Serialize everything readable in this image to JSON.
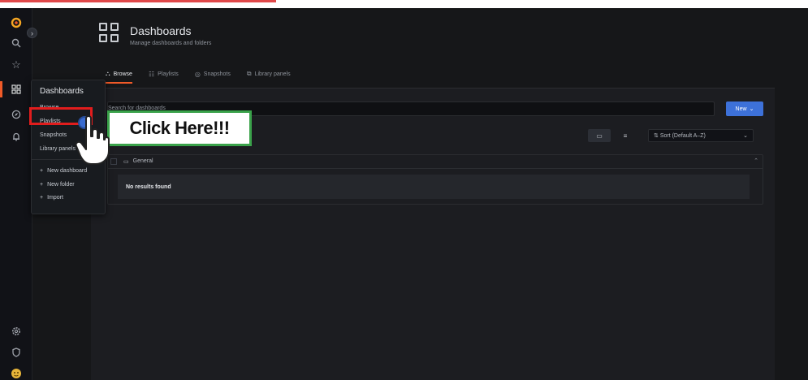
{
  "header": {
    "title": "Dashboards",
    "subtitle": "Manage dashboards and folders"
  },
  "tabs": [
    {
      "label": "Browse",
      "icon": "sitemap-icon"
    },
    {
      "label": "Playlists",
      "icon": "playlist-icon"
    },
    {
      "label": "Snapshots",
      "icon": "camera-icon"
    },
    {
      "label": "Library panels",
      "icon": "library-icon"
    }
  ],
  "toolbar": {
    "search_placeholder": "Search for dashboards",
    "new_label": "New",
    "sort_label": "Sort (Default A–Z)"
  },
  "folders": [
    {
      "name": "General",
      "empty_text": "No results found"
    }
  ],
  "flyout": {
    "heading": "Dashboards",
    "items": [
      "Browse",
      "Playlists",
      "Snapshots",
      "Library panels"
    ],
    "actions": [
      "New dashboard",
      "New folder",
      "Import"
    ]
  },
  "callout": {
    "text": "Click Here!!!"
  },
  "colors": {
    "background": "#161719",
    "accent": "#f05a28",
    "primary_button": "#3d71d9",
    "highlight_box": "#e11d1d",
    "callout_border": "#3aa24a"
  },
  "icons": {
    "rail": [
      "grafana-logo-icon",
      "search-icon",
      "star-icon",
      "dashboards-icon",
      "compass-icon",
      "bell-icon",
      "gear-icon",
      "shield-icon",
      "avatar-icon"
    ]
  }
}
